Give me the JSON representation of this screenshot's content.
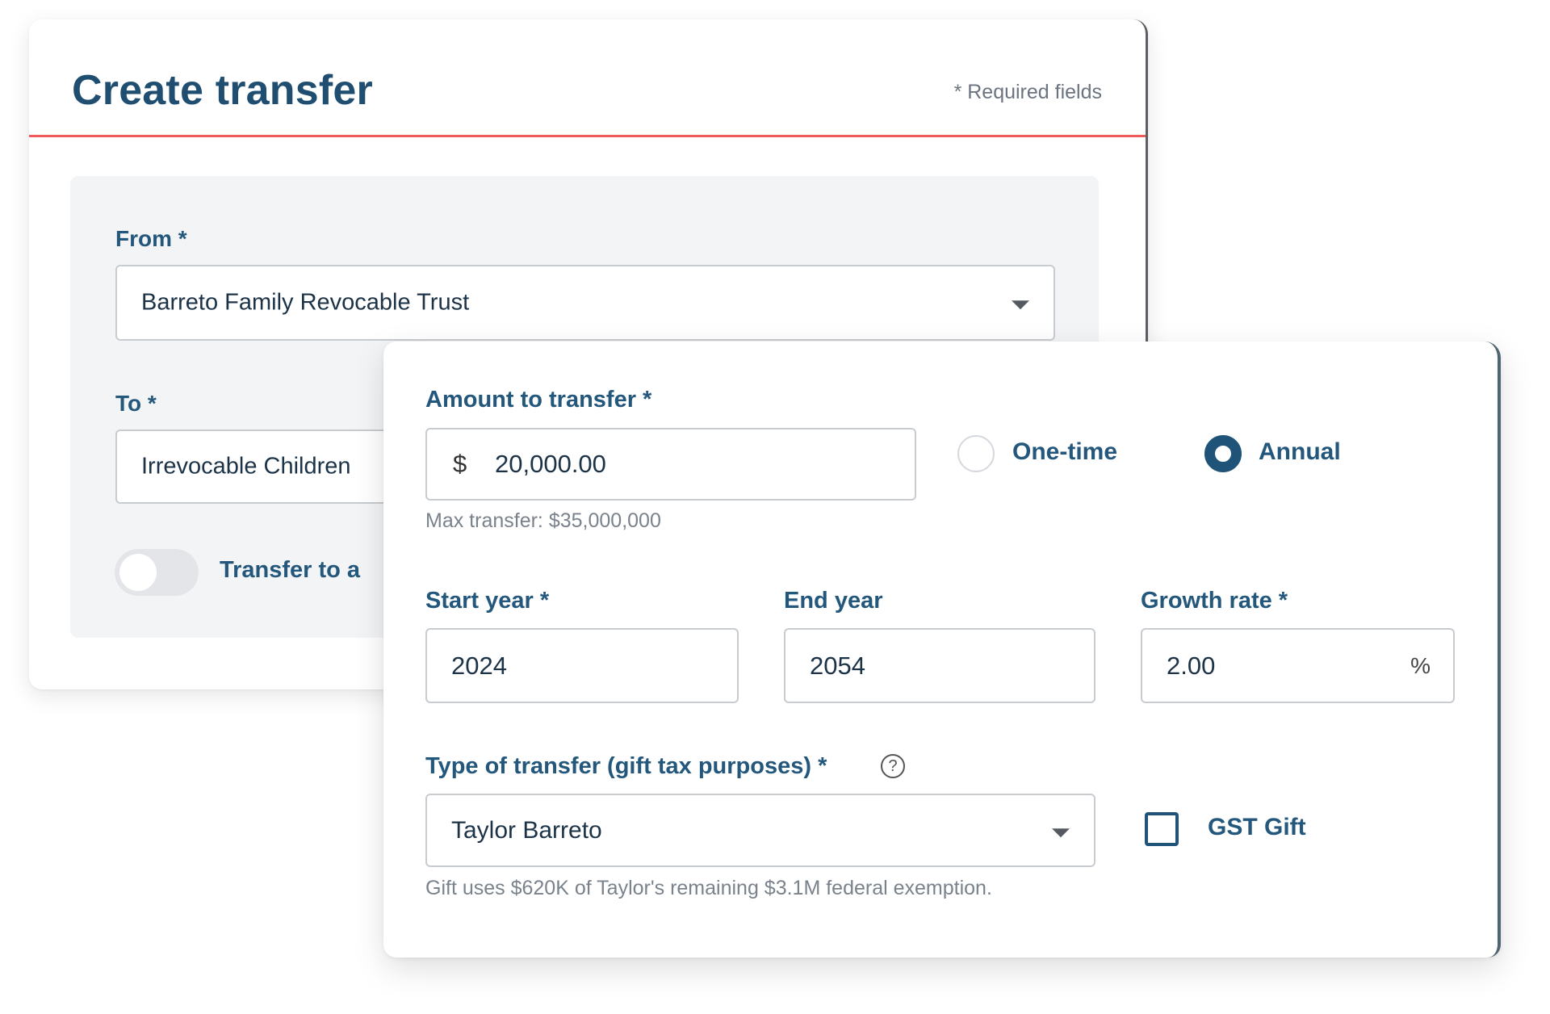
{
  "back_card": {
    "title": "Create transfer",
    "required_note": "* Required fields",
    "from": {
      "label": "From *",
      "value": "Barreto Family Revocable Trust"
    },
    "to": {
      "label": "To *",
      "value": "Irrevocable Children"
    },
    "toggle": {
      "label": "Transfer to a",
      "on": false
    }
  },
  "front_card": {
    "amount": {
      "label": "Amount to transfer *",
      "currency": "$",
      "value": "20,000.00",
      "hint": "Max transfer: $35,000,000"
    },
    "frequency": {
      "options": [
        {
          "label": "One-time",
          "selected": false
        },
        {
          "label": "Annual",
          "selected": true
        }
      ]
    },
    "start_year": {
      "label": "Start year *",
      "value": "2024"
    },
    "end_year": {
      "label": "End year",
      "value": "2054"
    },
    "growth_rate": {
      "label": "Growth rate *",
      "value": "2.00",
      "suffix": "%"
    },
    "transfer_type": {
      "label": "Type of transfer (gift tax purposes) *",
      "help_icon": "?",
      "value": "Taylor Barreto",
      "hint": "Gift uses $620K of Taylor's remaining $3.1M federal exemption."
    },
    "gst_gift": {
      "label": "GST Gift",
      "checked": false
    }
  },
  "colors": {
    "primary": "#1f5378",
    "accent_rule": "#ef5b5b",
    "panel_bg": "#f3f4f6",
    "hint_text": "#7a828c"
  }
}
